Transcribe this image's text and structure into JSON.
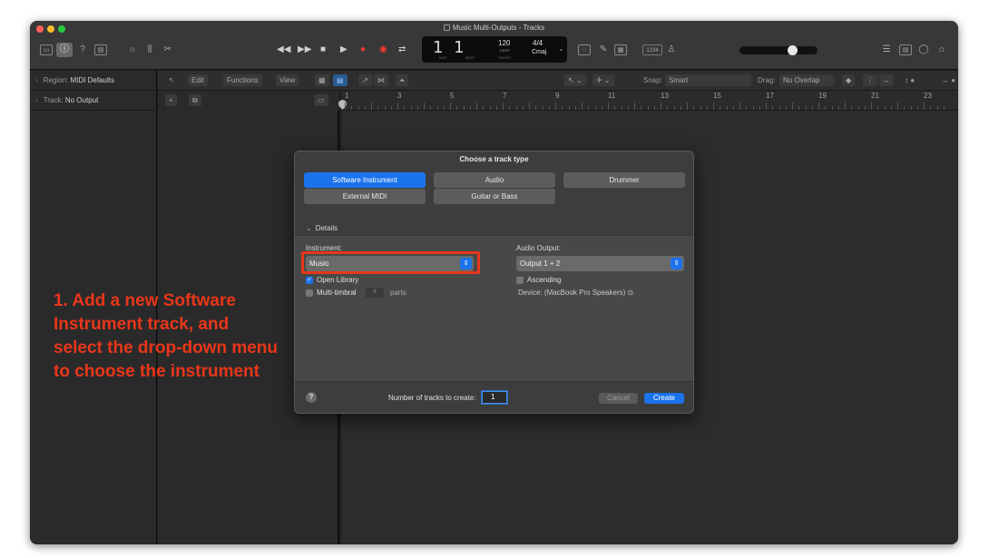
{
  "window": {
    "title": "Music Multi-Outputs - Tracks",
    "traffic_colors": [
      "#ff5f57",
      "#febc2e",
      "#28c840"
    ]
  },
  "toolbar": {
    "left_icons": [
      "library-icon",
      "info-icon",
      "help-icon",
      "media-icon",
      "brightness-icon",
      "mixer-icon",
      "scissors-icon"
    ],
    "transport": {
      "rewind": "◀◀",
      "forward": "▶▶",
      "stop": "■",
      "play": "▶",
      "record": "●",
      "record_alt": "◉",
      "cycle": "⇄"
    },
    "lcd": {
      "position": "1 1",
      "bar_label": "BAR",
      "beat_label": "BEAT",
      "tempo": "120",
      "tempo_mode": "KEEP",
      "tempo_label": "TEMPO",
      "signature": "4/4",
      "key": "Cmaj"
    },
    "count_in": "1234",
    "right_icons": [
      "list-icon",
      "note-pad-icon",
      "loop-browser-icon",
      "browser-icon"
    ]
  },
  "inspector": {
    "region_label": "Region:",
    "region_value": "MIDI Defaults",
    "track_label": "Track:",
    "track_value": "No Output"
  },
  "local_bar": {
    "edit": "Edit",
    "functions": "Functions",
    "view": "View",
    "snap_label": "Snap:",
    "snap_value": "Smart",
    "drag_label": "Drag:",
    "drag_value": "No Overlap"
  },
  "ruler": {
    "bars": [
      "1",
      "3",
      "5",
      "7",
      "9",
      "11",
      "13",
      "15",
      "17",
      "19",
      "21",
      "23"
    ]
  },
  "dialog": {
    "title": "Choose a track type",
    "track_types": [
      "Software Instrument",
      "Audio",
      "Drummer",
      "External MIDI",
      "Guitar or Bass"
    ],
    "selected_type": "Software Instrument",
    "details_label": "Details",
    "instrument_label": "Instrument:",
    "instrument_value": "Musio",
    "open_library_label": "Open Library",
    "open_library_checked": true,
    "multi_timbral_label": "Multi-timbral",
    "multi_timbral_checked": false,
    "parts_value": "8",
    "parts_label": "parts",
    "audio_output_label": "Audio Output:",
    "audio_output_value": "Output 1 + 2",
    "ascending_label": "Ascending",
    "ascending_checked": false,
    "device_text": "Device: (MacBook Pro Speakers)",
    "tracks_label": "Number of tracks to create:",
    "tracks_value": "1",
    "cancel_label": "Cancel",
    "create_label": "Create",
    "accent_color": "#1b73ec"
  },
  "annotation": {
    "text": "1. Add a new Software Instrument track, and select the drop-down menu to choose the instrument",
    "color": "#e8361a"
  }
}
